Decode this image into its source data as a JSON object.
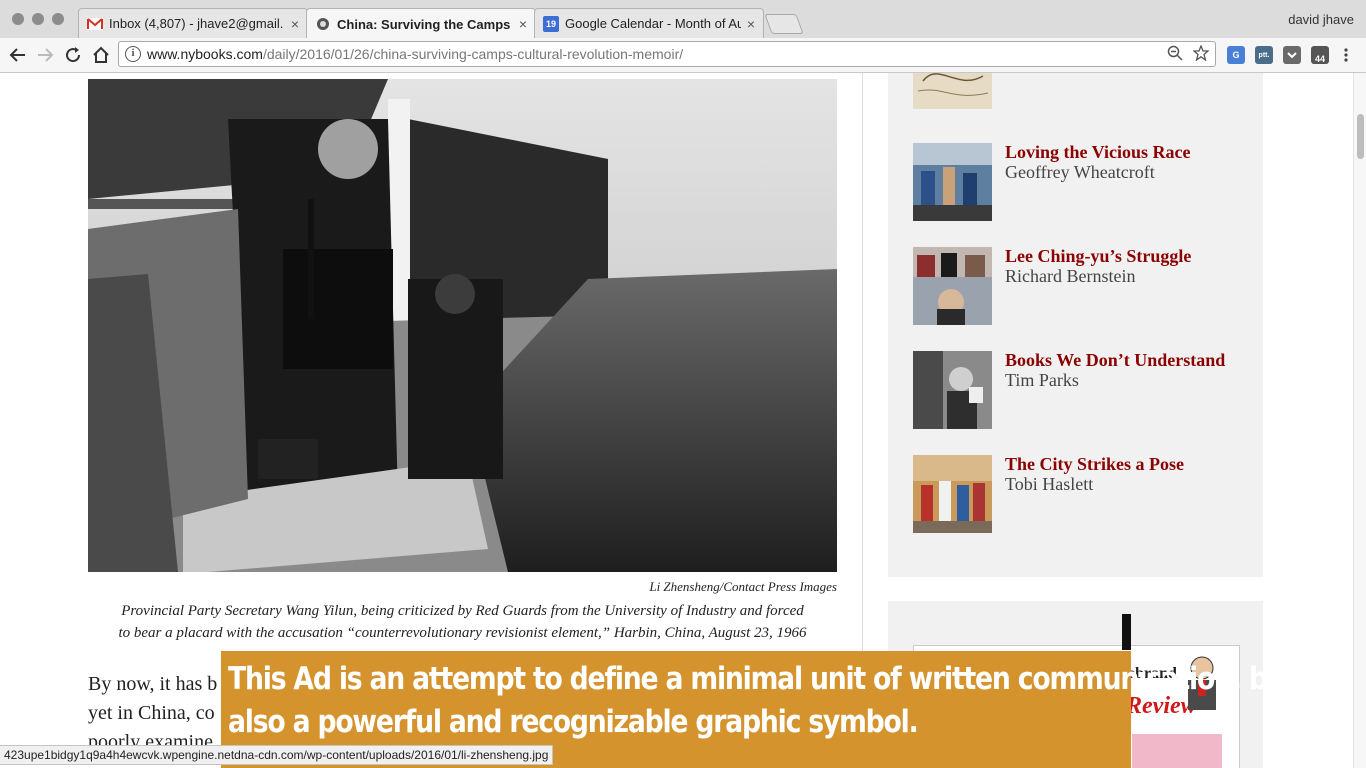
{
  "browser": {
    "tabs": [
      {
        "title": "Inbox (4,807) - jhave2@gmail.",
        "icon": "gmail-icon"
      },
      {
        "title": "China: Surviving the Camps |",
        "icon": "nyrb-icon",
        "active": true
      },
      {
        "title": "Google Calendar - Month of Au",
        "icon": "calendar-icon",
        "badge": "19"
      }
    ],
    "close_glyph": "×",
    "profile_name": "david jhave",
    "url_host": "www.nybooks.com",
    "url_path": "/daily/2016/01/26/china-surviving-camps-cultural-revolution-memoir/",
    "extensions": [
      {
        "name": "translate-extension-icon",
        "label": "G",
        "color": "#4a7fd8"
      },
      {
        "name": "ptt-extension-icon",
        "label": "ptt.",
        "color": "#4a6d8c"
      },
      {
        "name": "pocket-extension-icon",
        "label": "",
        "color": "#6a6a6a"
      },
      {
        "name": "notification-extension-icon",
        "label": "44",
        "color": "#555555"
      }
    ]
  },
  "article": {
    "photo_credit": "Li Zhensheng/Contact Press Images",
    "caption_lines": [
      "Provincial Party Secretary Wang Yilun, being criticized by Red Guards from the University of Industry and forced",
      "to bear a placard with the accusation “counterrevolutionary revisionist element,” Harbin, China, August 23, 1966"
    ],
    "body_lines": [
      "By now, it has b",
      "yet in China, co",
      "poorly examine"
    ]
  },
  "sidebar": {
    "items": [
      {
        "title": "Loving the Vicious Race",
        "author": "Geoffrey Wheatcroft"
      },
      {
        "title": "Lee Ching-yu’s Struggle",
        "author": "Richard Bernstein"
      },
      {
        "title": "Books We Don’t Understand",
        "author": "Tim Parks"
      },
      {
        "title": "The City Strikes a Pose",
        "author": "Tobi Haslett"
      }
    ]
  },
  "ad": {
    "banner_lines": [
      "This Ad is an attempt to define a minimal unit of written communication, but",
      "also a powerful and recognizable graphic symbol."
    ],
    "magazine_line1": "ebrand",
    "magazine_line2": "Review"
  },
  "status_url": "423upe1bidgy1q9a4h4ewcvk.wpengine.netdna-cdn.com/wp-content/uploads/2016/01/li-zhensheng.jpg",
  "colors": {
    "accent_red": "#8b0000",
    "ad_orange": "#d5932e"
  }
}
